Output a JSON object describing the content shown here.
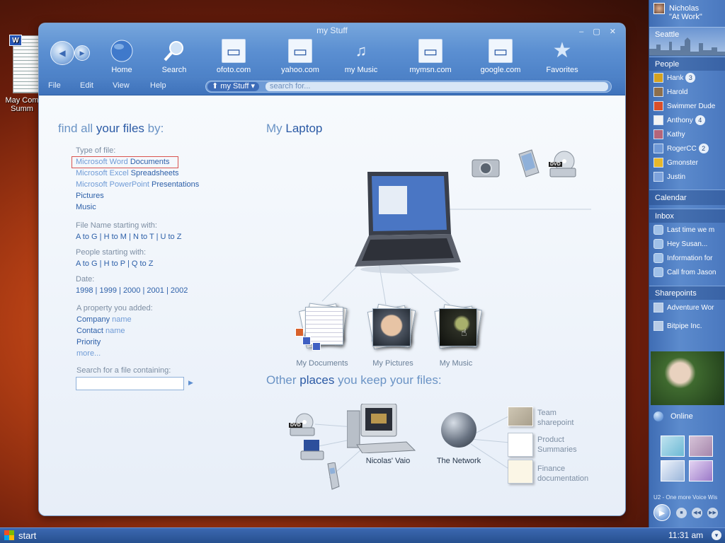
{
  "desktop": {
    "icon_label_line1": "May Com",
    "icon_label_line2": "Summ",
    "icon_badge": "W"
  },
  "window": {
    "title": "my Stuff",
    "controls": "‒ ▢ ✕",
    "toolbar": {
      "back_glyph": "◀",
      "forward_glyph": "▶",
      "buttons": [
        {
          "label": "Home",
          "icon": "globe-icon"
        },
        {
          "label": "Search",
          "icon": "magnifier-icon"
        },
        {
          "label": "ofoto.com",
          "icon": "webpage-icon"
        },
        {
          "label": "yahoo.com",
          "icon": "webpage-icon"
        },
        {
          "label": "my Music",
          "icon": "music-note-icon"
        },
        {
          "label": "mymsn.com",
          "icon": "webpage-icon"
        },
        {
          "label": "google.com",
          "icon": "webpage-icon"
        },
        {
          "label": "Favorites",
          "icon": "star-icon"
        }
      ]
    },
    "menu": [
      "File",
      "Edit",
      "View",
      "Help"
    ],
    "address": {
      "location": "my Stuff",
      "search_placeholder": "search for..."
    }
  },
  "left": {
    "heading_pre": "find all ",
    "heading_bold": "your files",
    "heading_post": " by:",
    "type_label": "Type of file:",
    "types": [
      {
        "pre": "Microsoft Word ",
        "bold": "Documents"
      },
      {
        "pre": "Microsoft Excel ",
        "bold": "Spreadsheets"
      },
      {
        "pre": "Microsoft PowerPoint ",
        "bold": "Presentations"
      },
      {
        "pre": "",
        "bold": "Pictures"
      },
      {
        "pre": "",
        "bold": "Music"
      }
    ],
    "filename_label": "File Name starting with:",
    "filename_ranges": [
      "A to G",
      "H to M",
      "N to T",
      "U to Z"
    ],
    "people_label": "People starting with:",
    "people_ranges": [
      "A to G",
      "H to P",
      "Q to Z"
    ],
    "date_label": "Date:",
    "years": [
      "1998",
      "1999",
      "2000",
      "2001",
      "2002"
    ],
    "property_label": "A property you added:",
    "properties": [
      {
        "bold": "Company",
        "rest": " name"
      },
      {
        "bold": "Contact",
        "rest": " name"
      },
      {
        "bold": "Priority",
        "rest": ""
      }
    ],
    "more": "more...",
    "search_label": "Search for a file containing:",
    "go_glyph": "▶"
  },
  "laptop": {
    "heading_pre": "My ",
    "heading_bold": "Laptop",
    "folders": [
      "My Documents",
      "My Pictures",
      "My Music"
    ],
    "dvd_label": "DVD"
  },
  "places": {
    "heading_pre": "Other ",
    "heading_bold": "places",
    "heading_post": " you keep your files:",
    "computer": "Nicolas' Vaio",
    "network": "The Network",
    "shares": [
      {
        "line1": "Team",
        "line2": "sharepoint"
      },
      {
        "line1": "Product",
        "line2": "Summaries"
      },
      {
        "line1": "Finance",
        "line2": "documentation"
      }
    ],
    "dvd_label": "DVD"
  },
  "sidebar": {
    "user_name": "Nicholas",
    "user_status": "\"At Work\"",
    "weather_city": "Seattle",
    "people_title": "People",
    "people": [
      {
        "name": "Hank",
        "count": "3",
        "color": "#d6a21f"
      },
      {
        "name": "Harold",
        "count": "",
        "color": "#8e6f4c"
      },
      {
        "name": "Swimmer Dude",
        "count": "",
        "color": "#d94f2a"
      },
      {
        "name": "Anthony",
        "count": "4",
        "color": "#f3f3f3"
      },
      {
        "name": "Kathy",
        "count": "",
        "color": "#b5657a"
      },
      {
        "name": "RogerCC",
        "count": "2",
        "color": "#6f98d6"
      },
      {
        "name": "Gmonster",
        "count": "",
        "color": "#e8b82a"
      },
      {
        "name": "Justin",
        "count": "",
        "color": "#7da2dc"
      }
    ],
    "calendar_title": "Calendar",
    "inbox_title": "Inbox",
    "inbox": [
      "Last time we m",
      "Hey Susan...",
      "Information for",
      "Call from Jason"
    ],
    "sharepoints_title": "Sharepoints",
    "sharepoints": [
      "Adventure Wor",
      "Bitpipe Inc."
    ],
    "online_label": "Online",
    "now_playing": "U2 - One more Voice Wis"
  },
  "taskbar": {
    "start_label": "start",
    "clock": "11:31 am"
  }
}
